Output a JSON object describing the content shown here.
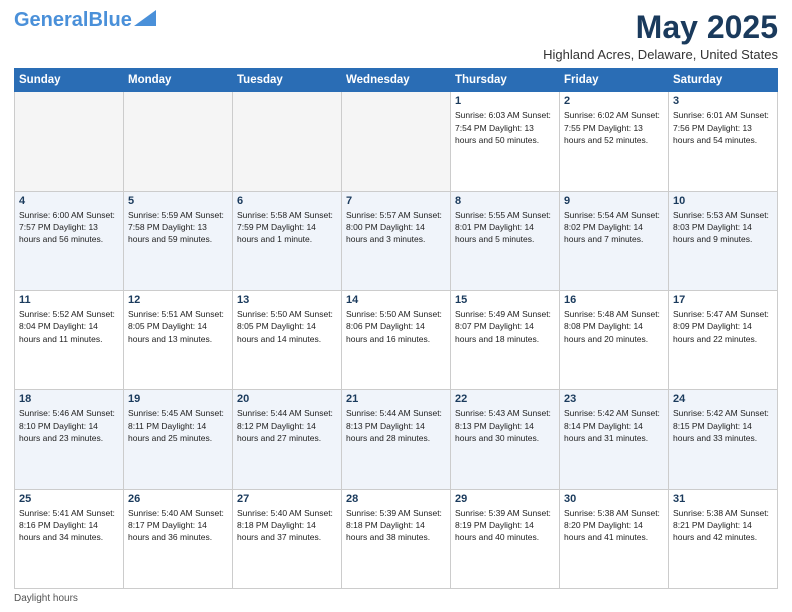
{
  "logo": {
    "text1": "General",
    "text2": "Blue"
  },
  "title": "May 2025",
  "location": "Highland Acres, Delaware, United States",
  "days_header": [
    "Sunday",
    "Monday",
    "Tuesday",
    "Wednesday",
    "Thursday",
    "Friday",
    "Saturday"
  ],
  "footer": "Daylight hours",
  "weeks": [
    [
      {
        "day": "",
        "info": ""
      },
      {
        "day": "",
        "info": ""
      },
      {
        "day": "",
        "info": ""
      },
      {
        "day": "",
        "info": ""
      },
      {
        "day": "1",
        "info": "Sunrise: 6:03 AM\nSunset: 7:54 PM\nDaylight: 13 hours\nand 50 minutes."
      },
      {
        "day": "2",
        "info": "Sunrise: 6:02 AM\nSunset: 7:55 PM\nDaylight: 13 hours\nand 52 minutes."
      },
      {
        "day": "3",
        "info": "Sunrise: 6:01 AM\nSunset: 7:56 PM\nDaylight: 13 hours\nand 54 minutes."
      }
    ],
    [
      {
        "day": "4",
        "info": "Sunrise: 6:00 AM\nSunset: 7:57 PM\nDaylight: 13 hours\nand 56 minutes."
      },
      {
        "day": "5",
        "info": "Sunrise: 5:59 AM\nSunset: 7:58 PM\nDaylight: 13 hours\nand 59 minutes."
      },
      {
        "day": "6",
        "info": "Sunrise: 5:58 AM\nSunset: 7:59 PM\nDaylight: 14 hours\nand 1 minute."
      },
      {
        "day": "7",
        "info": "Sunrise: 5:57 AM\nSunset: 8:00 PM\nDaylight: 14 hours\nand 3 minutes."
      },
      {
        "day": "8",
        "info": "Sunrise: 5:55 AM\nSunset: 8:01 PM\nDaylight: 14 hours\nand 5 minutes."
      },
      {
        "day": "9",
        "info": "Sunrise: 5:54 AM\nSunset: 8:02 PM\nDaylight: 14 hours\nand 7 minutes."
      },
      {
        "day": "10",
        "info": "Sunrise: 5:53 AM\nSunset: 8:03 PM\nDaylight: 14 hours\nand 9 minutes."
      }
    ],
    [
      {
        "day": "11",
        "info": "Sunrise: 5:52 AM\nSunset: 8:04 PM\nDaylight: 14 hours\nand 11 minutes."
      },
      {
        "day": "12",
        "info": "Sunrise: 5:51 AM\nSunset: 8:05 PM\nDaylight: 14 hours\nand 13 minutes."
      },
      {
        "day": "13",
        "info": "Sunrise: 5:50 AM\nSunset: 8:05 PM\nDaylight: 14 hours\nand 14 minutes."
      },
      {
        "day": "14",
        "info": "Sunrise: 5:50 AM\nSunset: 8:06 PM\nDaylight: 14 hours\nand 16 minutes."
      },
      {
        "day": "15",
        "info": "Sunrise: 5:49 AM\nSunset: 8:07 PM\nDaylight: 14 hours\nand 18 minutes."
      },
      {
        "day": "16",
        "info": "Sunrise: 5:48 AM\nSunset: 8:08 PM\nDaylight: 14 hours\nand 20 minutes."
      },
      {
        "day": "17",
        "info": "Sunrise: 5:47 AM\nSunset: 8:09 PM\nDaylight: 14 hours\nand 22 minutes."
      }
    ],
    [
      {
        "day": "18",
        "info": "Sunrise: 5:46 AM\nSunset: 8:10 PM\nDaylight: 14 hours\nand 23 minutes."
      },
      {
        "day": "19",
        "info": "Sunrise: 5:45 AM\nSunset: 8:11 PM\nDaylight: 14 hours\nand 25 minutes."
      },
      {
        "day": "20",
        "info": "Sunrise: 5:44 AM\nSunset: 8:12 PM\nDaylight: 14 hours\nand 27 minutes."
      },
      {
        "day": "21",
        "info": "Sunrise: 5:44 AM\nSunset: 8:13 PM\nDaylight: 14 hours\nand 28 minutes."
      },
      {
        "day": "22",
        "info": "Sunrise: 5:43 AM\nSunset: 8:13 PM\nDaylight: 14 hours\nand 30 minutes."
      },
      {
        "day": "23",
        "info": "Sunrise: 5:42 AM\nSunset: 8:14 PM\nDaylight: 14 hours\nand 31 minutes."
      },
      {
        "day": "24",
        "info": "Sunrise: 5:42 AM\nSunset: 8:15 PM\nDaylight: 14 hours\nand 33 minutes."
      }
    ],
    [
      {
        "day": "25",
        "info": "Sunrise: 5:41 AM\nSunset: 8:16 PM\nDaylight: 14 hours\nand 34 minutes."
      },
      {
        "day": "26",
        "info": "Sunrise: 5:40 AM\nSunset: 8:17 PM\nDaylight: 14 hours\nand 36 minutes."
      },
      {
        "day": "27",
        "info": "Sunrise: 5:40 AM\nSunset: 8:18 PM\nDaylight: 14 hours\nand 37 minutes."
      },
      {
        "day": "28",
        "info": "Sunrise: 5:39 AM\nSunset: 8:18 PM\nDaylight: 14 hours\nand 38 minutes."
      },
      {
        "day": "29",
        "info": "Sunrise: 5:39 AM\nSunset: 8:19 PM\nDaylight: 14 hours\nand 40 minutes."
      },
      {
        "day": "30",
        "info": "Sunrise: 5:38 AM\nSunset: 8:20 PM\nDaylight: 14 hours\nand 41 minutes."
      },
      {
        "day": "31",
        "info": "Sunrise: 5:38 AM\nSunset: 8:21 PM\nDaylight: 14 hours\nand 42 minutes."
      }
    ]
  ]
}
